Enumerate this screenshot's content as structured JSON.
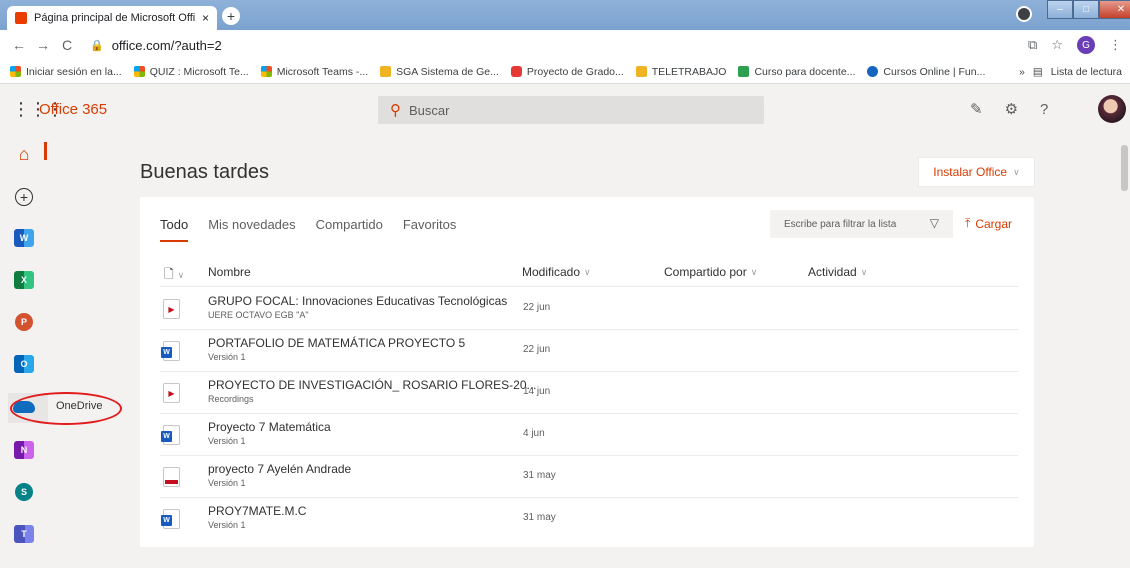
{
  "browser": {
    "tab_title": "Página principal de Microsoft Offi",
    "tab_close": "×",
    "new_tab": "+",
    "url": "office.com/?auth=2",
    "profile_initial": "G",
    "bookmarks": [
      {
        "label": "Iniciar sesión en la...",
        "icon": "microsoft-icon"
      },
      {
        "label": "QUIZ : Microsoft Te...",
        "icon": "microsoft-icon"
      },
      {
        "label": "Microsoft Teams -...",
        "icon": "microsoft-icon"
      },
      {
        "label": "SGA Sistema de Ge...",
        "icon": "sga-icon"
      },
      {
        "label": "Proyecto de Grado...",
        "icon": "youtube-icon"
      },
      {
        "label": "TELETRABAJO",
        "icon": "folder-icon"
      },
      {
        "label": "Curso para docente...",
        "icon": "course-icon"
      },
      {
        "label": "Cursos Online | Fun...",
        "icon": "movistar-icon"
      }
    ],
    "more_bookmarks": "»",
    "reading_list": "Lista de lectura"
  },
  "office": {
    "brand": "Office 365",
    "search_placeholder": "Buscar",
    "greeting": "Buenas tardes",
    "install_label": "Instalar Office",
    "tabs": [
      "Todo",
      "Mis novedades",
      "Compartido",
      "Favoritos"
    ],
    "filter_placeholder": "Escribe para filtrar la lista",
    "upload_label": "Cargar",
    "columns": [
      "Nombre",
      "Modificado",
      "Compartido por",
      "Actividad"
    ],
    "onedrive_tooltip": "OneDrive"
  },
  "files": [
    {
      "name": "GRUPO FOCAL: Innovaciones Educativas Tecnológicas",
      "sub": "UERE OCTAVO EGB \"A\"",
      "modified": "22 jun",
      "type": "video"
    },
    {
      "name": "PORTAFOLIO DE MATEMÁTICA PROYECTO 5",
      "sub": "Versión 1",
      "modified": "22 jun",
      "type": "word"
    },
    {
      "name": "PROYECTO DE INVESTIGACIÓN_ ROSARIO FLORES-20...",
      "sub": "Recordings",
      "modified": "14 jun",
      "type": "video"
    },
    {
      "name": "Proyecto 7 Matemática",
      "sub": "Versión 1",
      "modified": "4 jun",
      "type": "word"
    },
    {
      "name": "proyecto 7 Ayelén Andrade",
      "sub": "Versión 1",
      "modified": "31 may",
      "type": "recording"
    },
    {
      "name": "PROY7MATE.M.C",
      "sub": "Versión 1",
      "modified": "31 may",
      "type": "word"
    }
  ],
  "colors": {
    "accent": "#d83b01",
    "highlight_ring": "#e21b1b"
  }
}
